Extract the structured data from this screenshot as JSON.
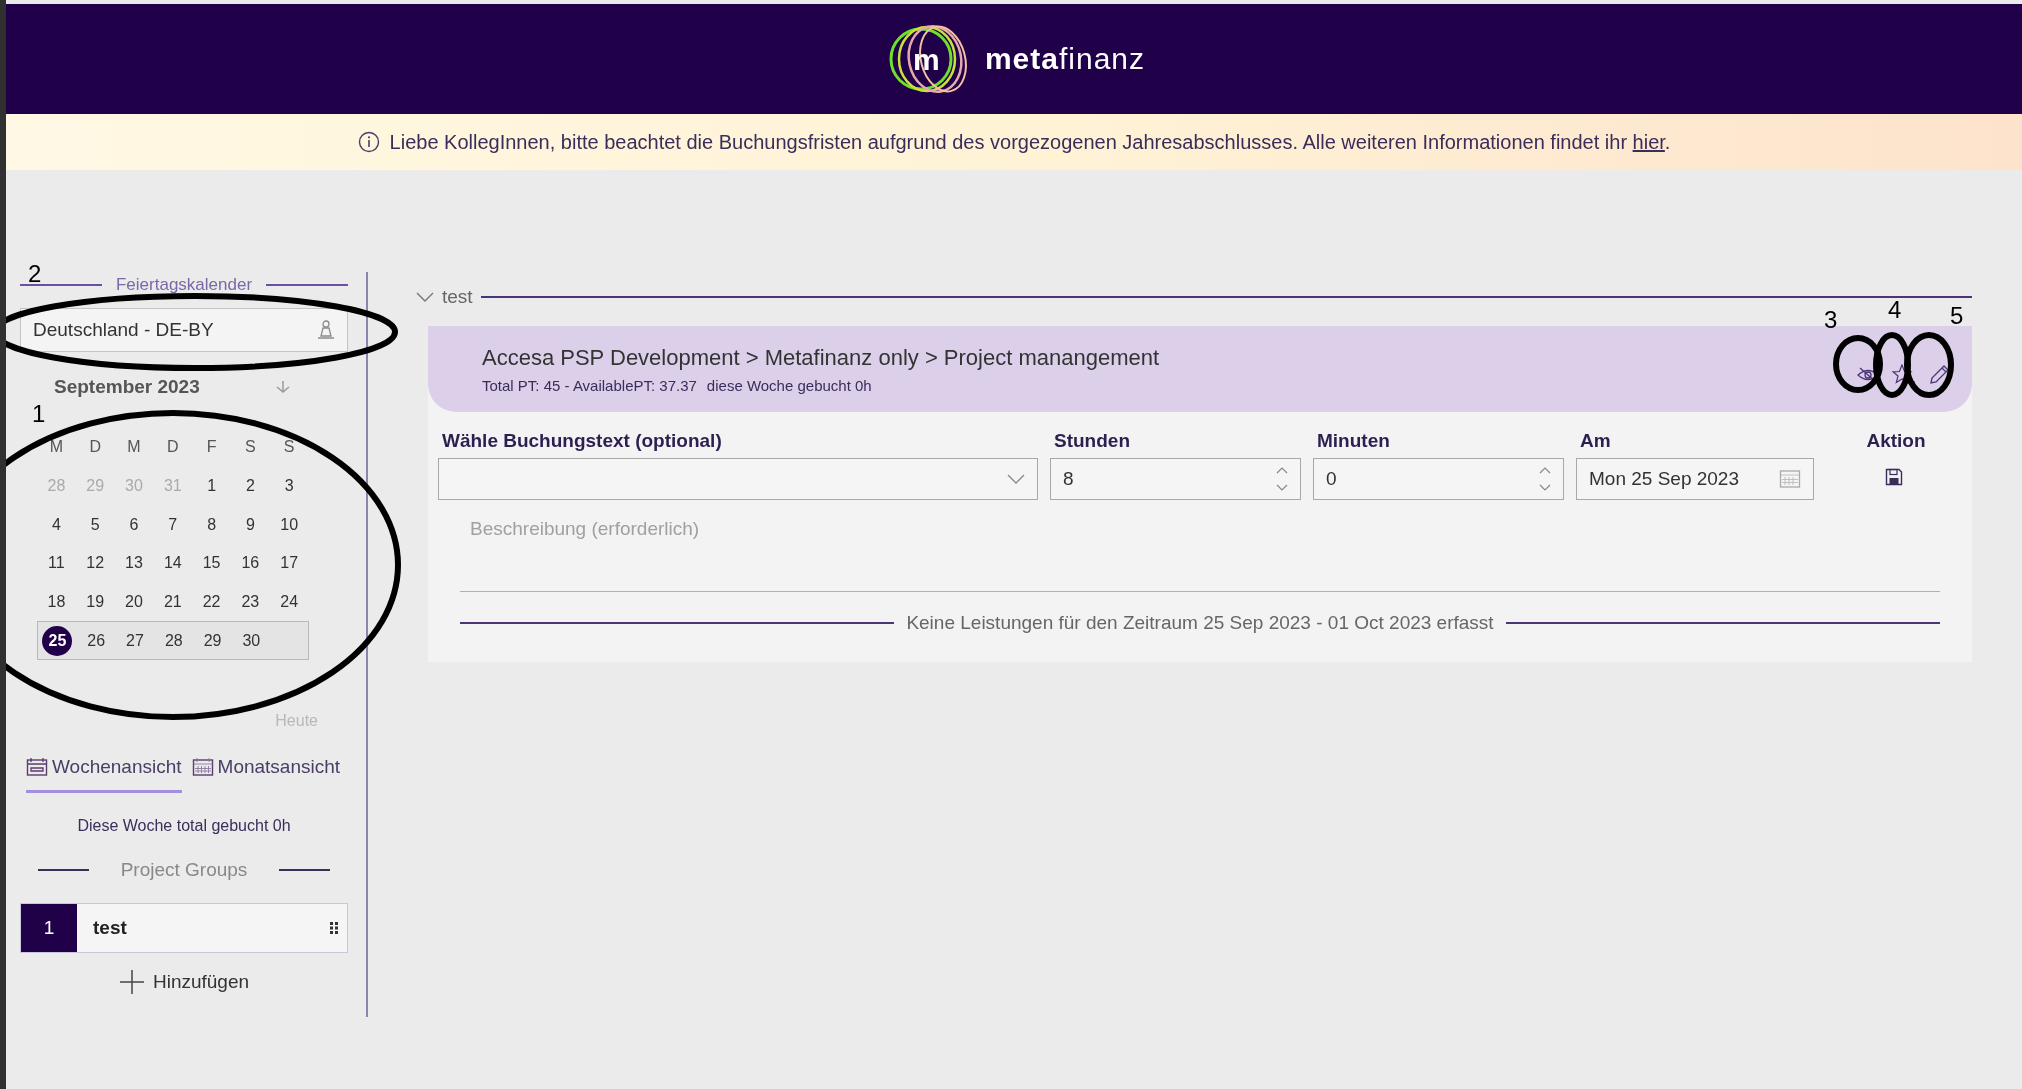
{
  "header": {
    "logo_mark": "m",
    "logo_text": "**meta**finanz"
  },
  "banner": {
    "message": "Liebe KollegInnen, bitte beachtet die Buchungsfristen aufgrund des vorgezogenen Jahresabschlusses. Alle weiteren Informationen findet ihr ",
    "link": "hier",
    "end": "."
  },
  "sidebar": {
    "holiday_heading": "Feiertagskalender",
    "holiday_value": "Deutschland - DE-BY",
    "calendar": {
      "month": "September 2023",
      "weekdays": [
        "M",
        "D",
        "M",
        "D",
        "F",
        "S",
        "S"
      ],
      "weeks": [
        {
          "current": false,
          "days": [
            {
              "day": "28",
              "muted": true,
              "selected": false
            },
            {
              "day": "29",
              "muted": true,
              "selected": false
            },
            {
              "day": "30",
              "muted": true,
              "selected": false
            },
            {
              "day": "31",
              "muted": true,
              "selected": false
            },
            {
              "day": "1",
              "muted": false,
              "selected": false
            },
            {
              "day": "2",
              "muted": false,
              "selected": false
            },
            {
              "day": "3",
              "muted": false,
              "selected": false
            }
          ]
        },
        {
          "current": false,
          "days": [
            {
              "day": "4",
              "muted": false,
              "selected": false
            },
            {
              "day": "5",
              "muted": false,
              "selected": false
            },
            {
              "day": "6",
              "muted": false,
              "selected": false
            },
            {
              "day": "7",
              "muted": false,
              "selected": false
            },
            {
              "day": "8",
              "muted": false,
              "selected": false
            },
            {
              "day": "9",
              "muted": false,
              "selected": false
            },
            {
              "day": "10",
              "muted": false,
              "selected": false
            }
          ]
        },
        {
          "current": false,
          "days": [
            {
              "day": "11",
              "muted": false,
              "selected": false
            },
            {
              "day": "12",
              "muted": false,
              "selected": false
            },
            {
              "day": "13",
              "muted": false,
              "selected": false
            },
            {
              "day": "14",
              "muted": false,
              "selected": false
            },
            {
              "day": "15",
              "muted": false,
              "selected": false
            },
            {
              "day": "16",
              "muted": false,
              "selected": false
            },
            {
              "day": "17",
              "muted": false,
              "selected": false
            }
          ]
        },
        {
          "current": false,
          "days": [
            {
              "day": "18",
              "muted": false,
              "selected": false
            },
            {
              "day": "19",
              "muted": false,
              "selected": false
            },
            {
              "day": "20",
              "muted": false,
              "selected": false
            },
            {
              "day": "21",
              "muted": false,
              "selected": false
            },
            {
              "day": "22",
              "muted": false,
              "selected": false
            },
            {
              "day": "23",
              "muted": false,
              "selected": false
            },
            {
              "day": "24",
              "muted": false,
              "selected": false
            }
          ]
        },
        {
          "current": true,
          "days": [
            {
              "day": "25",
              "muted": false,
              "selected": true
            },
            {
              "day": "26",
              "muted": false,
              "selected": false
            },
            {
              "day": "27",
              "muted": false,
              "selected": false
            },
            {
              "day": "28",
              "muted": false,
              "selected": false
            },
            {
              "day": "29",
              "muted": false,
              "selected": false
            },
            {
              "day": "30",
              "muted": false,
              "selected": false
            }
          ]
        }
      ],
      "today": "Heute"
    },
    "view_tabs": [
      {
        "label": "Wochenansicht",
        "kind": "week",
        "selected": true
      },
      {
        "label": "Monatsansicht",
        "kind": "month",
        "selected": false
      }
    ],
    "week_total": "Diese Woche total gebucht 0h",
    "groups_heading": "Project Groups",
    "groups": [
      {
        "number": "1",
        "name": "test"
      }
    ],
    "add_label": "Hinzufügen"
  },
  "main": {
    "group_title": "test",
    "expanded": true,
    "project": {
      "path": "Accesa PSP Development > Metafinanz only > Project manangement",
      "stats": "Total PT: 45 - AvailablePT: 37.37",
      "week": "diese Woche gebucht 0h"
    },
    "form": {
      "text_label": "Wähle Buchungstext (optional)",
      "hours_label": "Stunden",
      "hours": "8",
      "minutes_label": "Minuten",
      "minutes": "0",
      "date_label": "Am",
      "date": "Mon 25 Sep 2023",
      "action_label": "Aktion",
      "description_placeholder": "Beschreibung (erforderlich)"
    },
    "empty_message": "Keine Leistungen für den Zeitraum 25 Sep 2023 - 01 Oct 2023 erfasst"
  },
  "annotations": [
    {
      "label": "2"
    },
    {
      "label": "1"
    },
    {
      "label": "3"
    },
    {
      "label": "4"
    },
    {
      "label": "5"
    }
  ]
}
